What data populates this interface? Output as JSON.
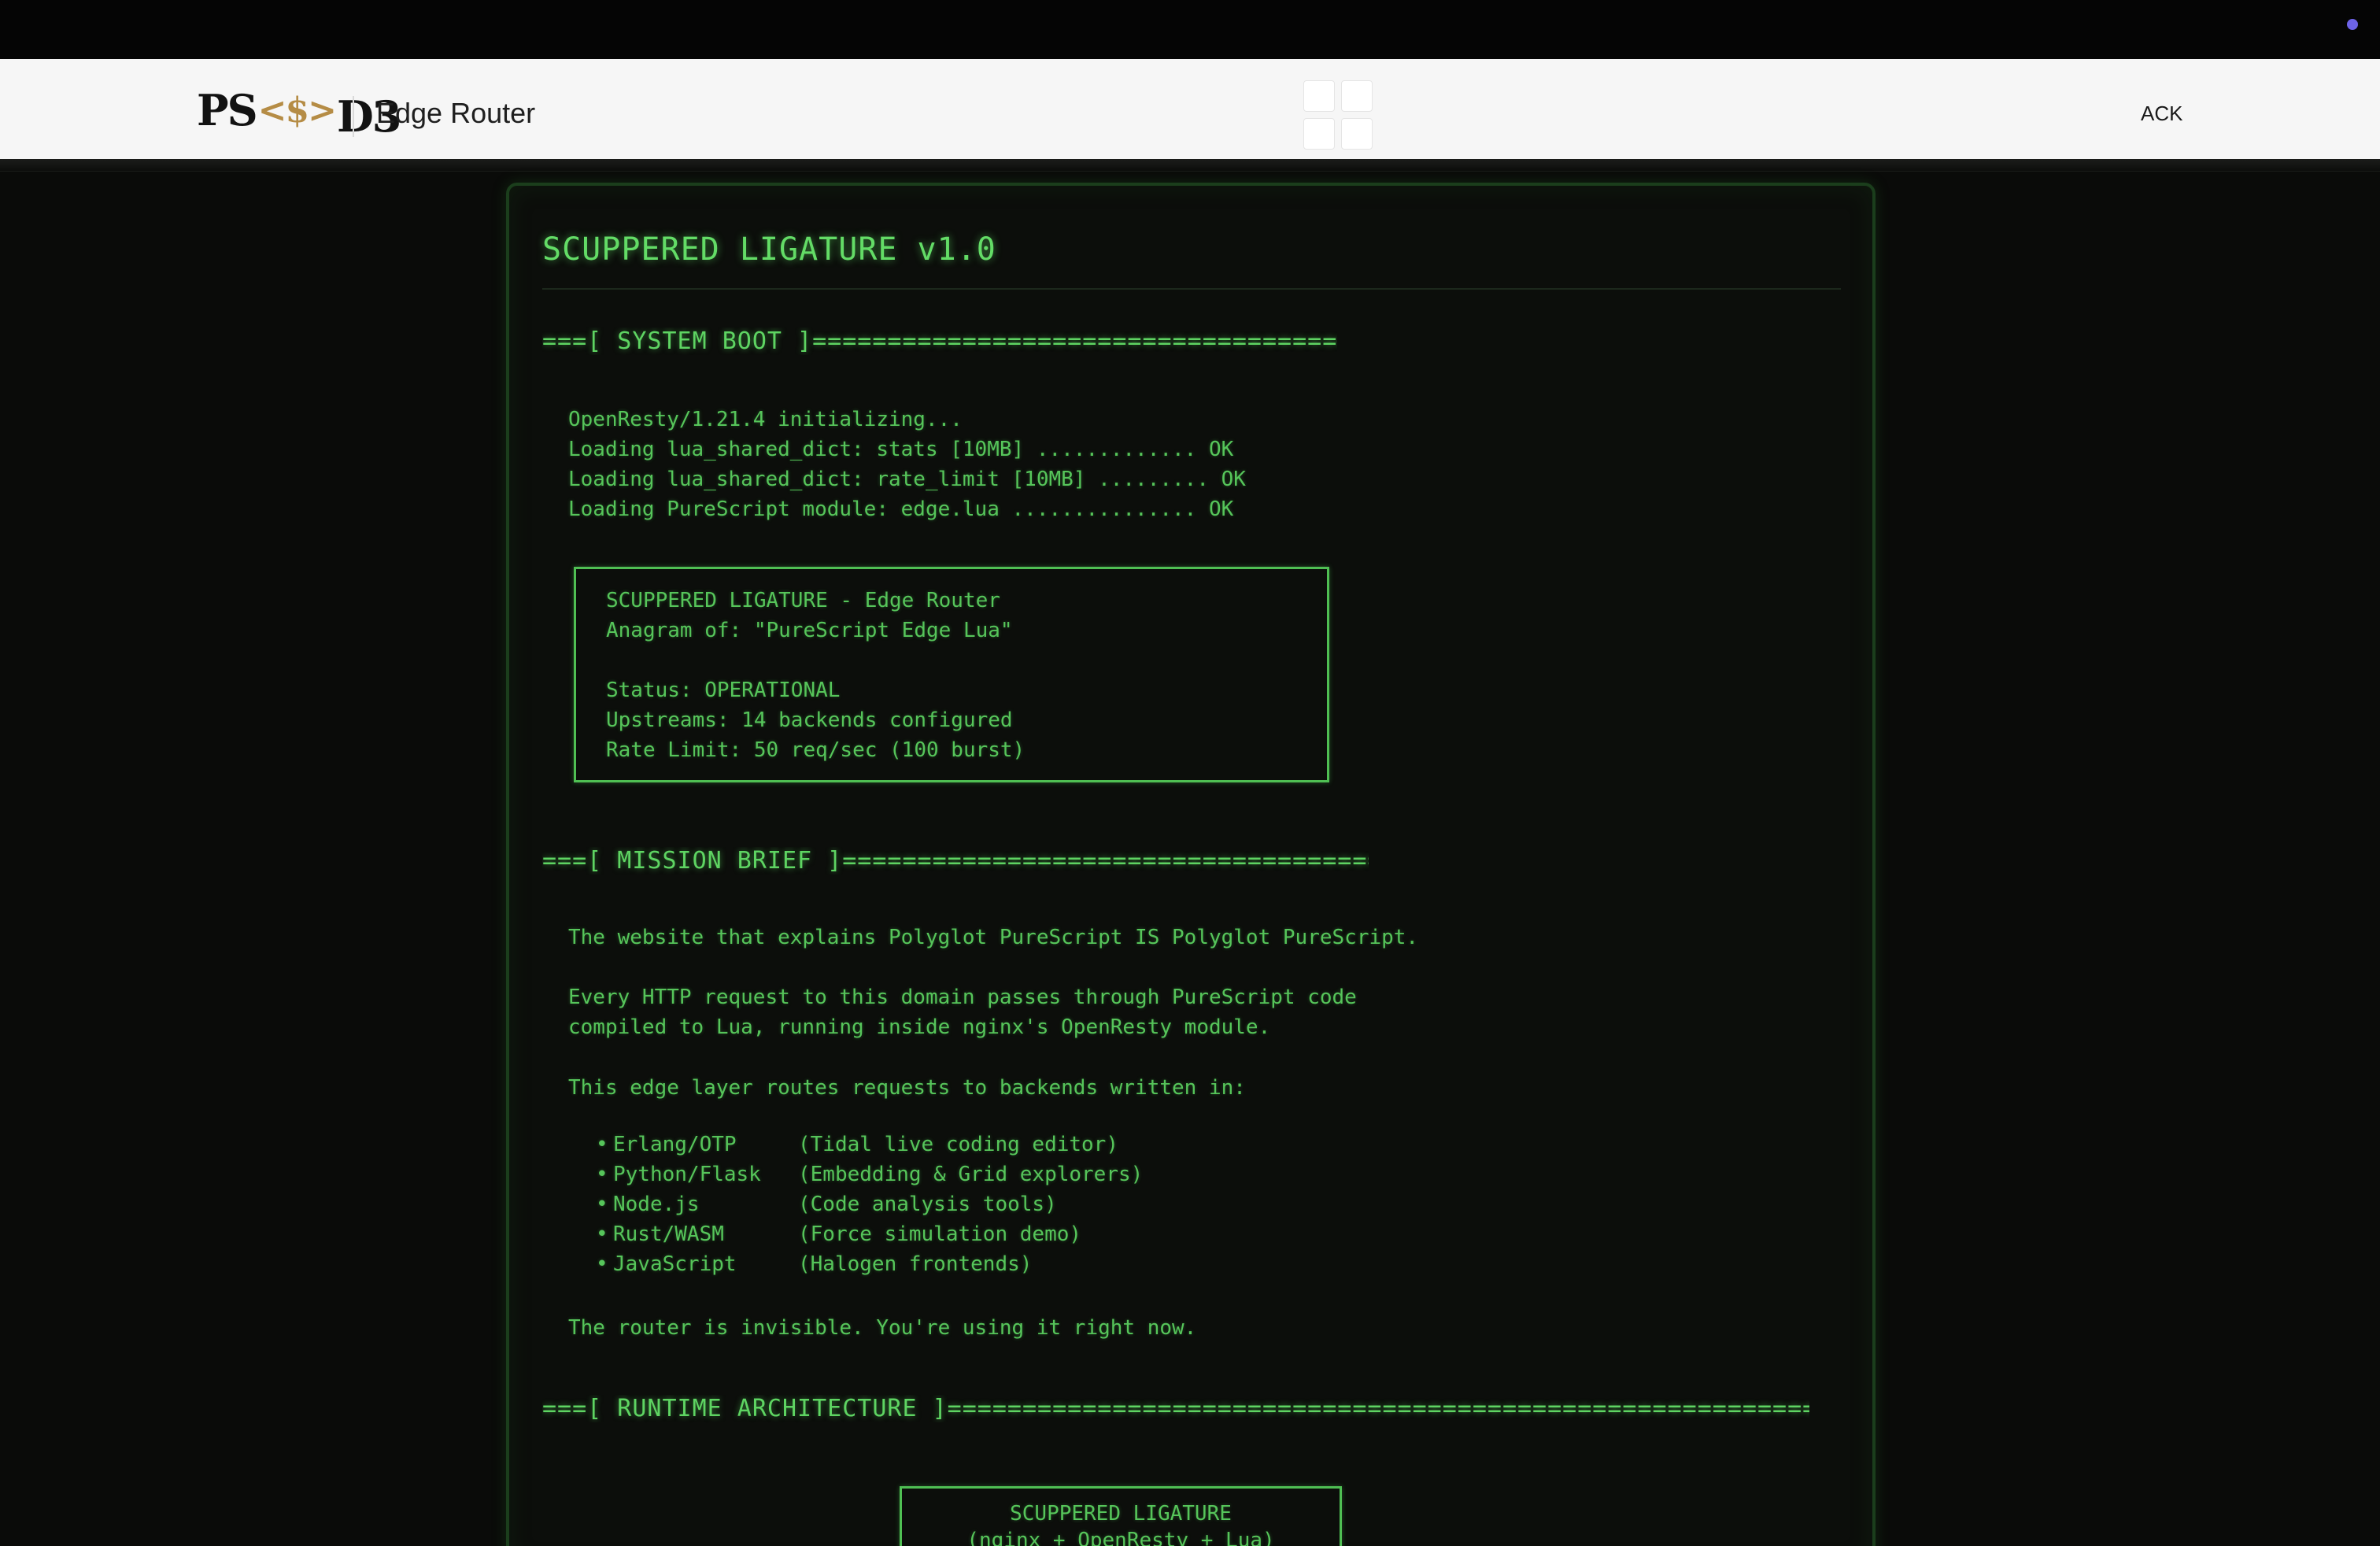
{
  "header": {
    "logo": {
      "ps": "PS",
      "amp": "<$>",
      "d3": "D3"
    },
    "title": "Edge Router",
    "ack_label": "ACK"
  },
  "terminal": {
    "title": "SCUPPERED LIGATURE v1.0",
    "sections": {
      "boot": "===[ SYSTEM BOOT ]=============================================================",
      "mission": "===[ MISSION BRIEF ]============================================================",
      "runtime": "===[ RUNTIME ARCHITECTURE ]=================================================================="
    },
    "boot_lines": [
      "OpenResty/1.21.4 initializing...",
      "Loading lua_shared_dict: stats [10MB] ............. OK",
      "Loading lua_shared_dict: rate_limit [10MB] ......... OK",
      "Loading PureScript module: edge.lua ............... OK"
    ],
    "status_box": [
      "SCUPPERED LIGATURE - Edge Router",
      "Anagram of: \"PureScript Edge Lua\"",
      "",
      "Status: OPERATIONAL",
      "Upstreams: 14 backends configured",
      "Rate Limit: 50 req/sec (100 burst)"
    ],
    "mission_lines": [
      "The website that explains Polyglot PureScript IS Polyglot PureScript.",
      "Every HTTP request to this domain passes through PureScript code",
      "compiled to Lua, running inside nginx's OpenResty module.",
      "This edge layer routes requests to backends written in:"
    ],
    "backends": [
      {
        "name": "Erlang/OTP",
        "desc": "(Tidal live coding editor)"
      },
      {
        "name": "Python/Flask",
        "desc": "(Embedding & Grid explorers)"
      },
      {
        "name": "Node.js",
        "desc": "(Code analysis tools)"
      },
      {
        "name": "Rust/WASM",
        "desc": "(Force simulation demo)"
      },
      {
        "name": "JavaScript",
        "desc": "(Halogen frontends)"
      }
    ],
    "closing_line": "The router is invisible. You're using it right now.",
    "arch_box": {
      "line1": "SCUPPERED LIGATURE",
      "line2": "(nginx + OpenResty + Lua)"
    }
  }
}
